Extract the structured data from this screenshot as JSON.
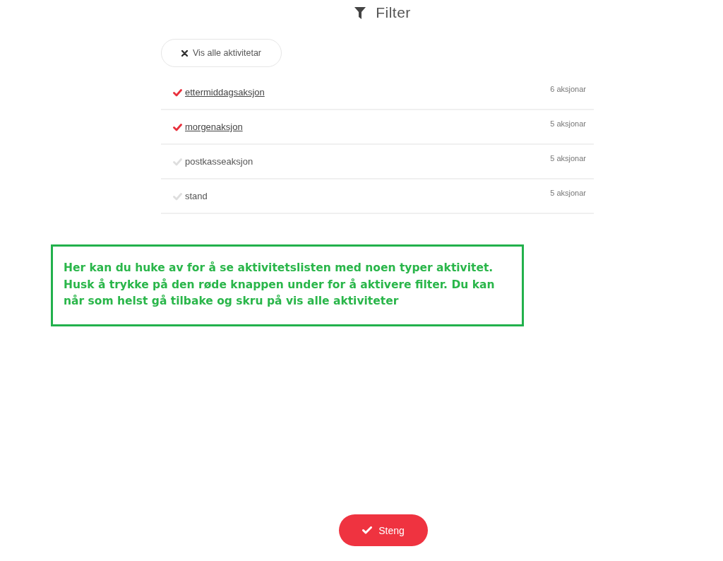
{
  "header": {
    "title": "Filter"
  },
  "clear_button": {
    "label": "Vis alle aktivitetar"
  },
  "activities": [
    {
      "name": "ettermiddagsaksjon",
      "count": "6 aksjonar",
      "selected": true
    },
    {
      "name": "morgenaksjon",
      "count": "5 aksjonar",
      "selected": true
    },
    {
      "name": "postkasseaksjon",
      "count": "5 aksjonar",
      "selected": false
    },
    {
      "name": "stand",
      "count": "5 aksjonar",
      "selected": false
    }
  ],
  "callout": {
    "lines": [
      "Her kan du huke av for å se aktivitetslisten med noen typer aktivitet.",
      "Husk å trykke på den røde knappen under for å aktivere filter. Du kan",
      "når som helst gå tilbake og skru på vis alle aktiviteter"
    ]
  },
  "close_button": {
    "label": "Steng"
  }
}
